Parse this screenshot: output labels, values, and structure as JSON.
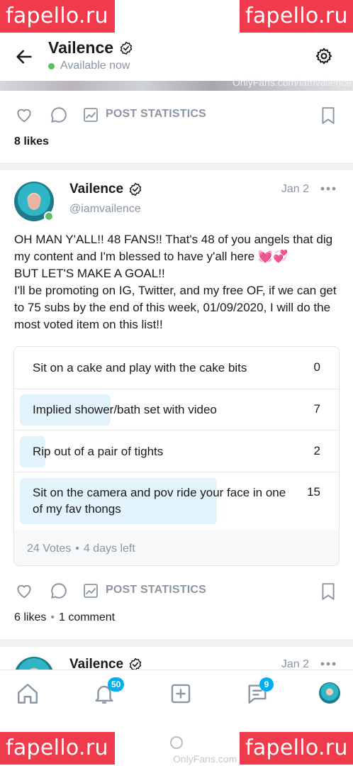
{
  "watermark": {
    "text": "fapello.ru"
  },
  "header": {
    "name": "Vailence",
    "status": "Available now"
  },
  "media": {
    "caption": "OnlyFans.com/iamvailence"
  },
  "actions": {
    "stats_label": "POST STATISTICS"
  },
  "post_top": {
    "likes": "8 likes"
  },
  "post": {
    "name": "Vailence",
    "handle": "@iamvailence",
    "date": "Jan 2",
    "text": [
      "OH MAN Y'ALL!! 48 FANS!! That's 48 of you angels that dig my content and I'm blessed to have y'all here 💓💞",
      "BUT LET'S MAKE A GOAL!!",
      "I'll be promoting on IG, Twitter, and my free OF, if we can get to 75 subs by the end of this week, 01/09/2020, I will do the most voted item on this list!!"
    ],
    "poll": {
      "options": [
        {
          "label": "Sit on a cake and play with the cake bits",
          "votes": "0",
          "share": 0
        },
        {
          "label": "Implied shower/bath set with video",
          "votes": "7",
          "share": 0.29
        },
        {
          "label": "Rip out of a pair of tights",
          "votes": "2",
          "share": 0.08
        },
        {
          "label": "Sit on the camera and pov ride your face in one of my fav thongs",
          "votes": "15",
          "share": 0.63
        }
      ],
      "total": "24 Votes",
      "time_left": "4 days left"
    },
    "likes": "6 likes",
    "comments": "1 comment"
  },
  "post_next": {
    "name": "Vailence",
    "date": "Jan 2"
  },
  "nav": {
    "notifications_badge": "50",
    "messages_badge": "9"
  },
  "system": {
    "footer_watermark": "OnlyFans.com"
  },
  "colors": {
    "accent": "#00aff0",
    "online": "#5cbf62",
    "muted": "#8a96a3",
    "poll_fill": "#e2f3fc",
    "watermark": "#ef3b4c"
  }
}
